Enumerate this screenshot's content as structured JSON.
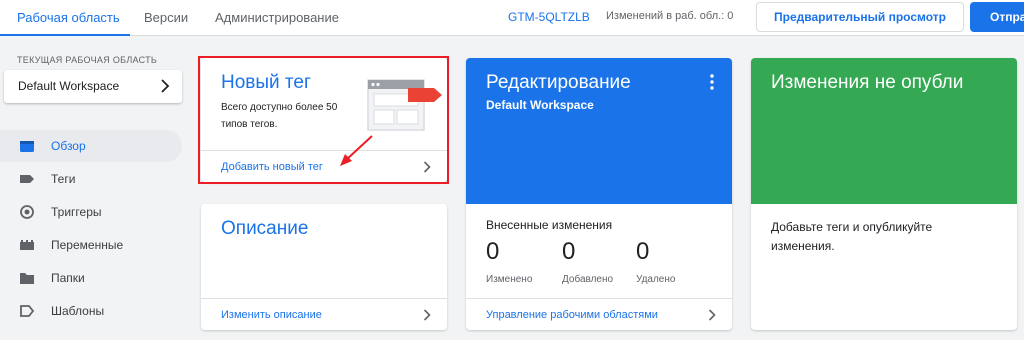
{
  "tabs": [
    {
      "label": "Рабочая область",
      "active": true
    },
    {
      "label": "Версии",
      "active": false
    },
    {
      "label": "Администрирование",
      "active": false
    }
  ],
  "header": {
    "container_id": "GTM-5QLTZLB",
    "changes_count": "Изменений в раб. обл.: 0",
    "preview_button": "Предварительный просмотр",
    "submit_button": "Отпра"
  },
  "sidebar": {
    "workspace_caption": "ТЕКУЩАЯ РАБОЧАЯ ОБЛАСТЬ",
    "workspace_name": "Default Workspace",
    "items": [
      {
        "label": "Обзор",
        "icon": "overview-icon",
        "active": true
      },
      {
        "label": "Теги",
        "icon": "tag-icon",
        "active": false
      },
      {
        "label": "Триггеры",
        "icon": "trigger-icon",
        "active": false
      },
      {
        "label": "Переменные",
        "icon": "variables-icon",
        "active": false
      },
      {
        "label": "Папки",
        "icon": "folder-icon",
        "active": false
      },
      {
        "label": "Шаблоны",
        "icon": "templates-icon",
        "active": false
      }
    ]
  },
  "cards": {
    "new_tag": {
      "title": "Новый тег",
      "description": "Всего доступно более 50 типов тегов.",
      "link": "Добавить новый тег"
    },
    "description": {
      "title": "Описание",
      "link": "Изменить описание"
    },
    "editing": {
      "title": "Редактирование",
      "subtitle": "Default Workspace",
      "changes_label": "Внесенные изменения",
      "stats": [
        {
          "value": "0",
          "label": "Изменено"
        },
        {
          "value": "0",
          "label": "Добавлено"
        },
        {
          "value": "0",
          "label": "Удалено"
        }
      ],
      "link": "Управление рабочими областями"
    },
    "unpublished": {
      "title": "Изменения не опубли",
      "text": "Добавьте теги и опубликуйте изменения."
    }
  },
  "colors": {
    "accent": "#1a73e8",
    "editing_bg": "#1a73e8",
    "unpublished_bg": "#34a853",
    "highlight": "#ea1e24"
  }
}
